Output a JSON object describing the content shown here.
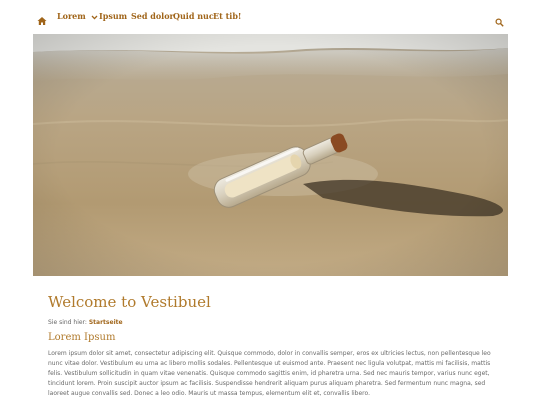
{
  "nav": {
    "home_icon": "home-icon",
    "items": [
      {
        "label": "Lorem",
        "has_dropdown": true
      },
      {
        "label": "Ipsum"
      },
      {
        "label": "Sed dolor"
      },
      {
        "label": "Quid nuc"
      },
      {
        "label": "Et tib!"
      }
    ],
    "search_icon": "search-icon",
    "accent_color": "#a0651a"
  },
  "hero": {
    "image": "message-in-a-bottle-on-beach"
  },
  "page": {
    "title": "Welcome to Vestibuel",
    "breadcrumb_prefix": "Sie sind hier:",
    "breadcrumb_link": "Startseite",
    "section_title": "Lorem Ipsum",
    "body": "Lorem ipsum dolor sit amet, consectetur adipiscing elit. Quisque commodo, dolor in convallis semper, eros ex ultricies lectus, non pellentesque leo nunc vitae dolor. Vestibulum eu urna ac libero mollis sodales. Pellentesque ut euismod ante. Praesent nec ligula volutpat, mattis mi facilisis, mattis felis. Vestibulum sollicitudin in quam vitae venenatis. Quisque commodo sagittis enim, id pharetra urna. Sed nec mauris tempor, varius nunc eget, tincidunt lorem. Proin suscipit auctor ipsum ac facilisis. Suspendisse hendrerit aliquam purus aliquam pharetra. Sed fermentum nunc magna, sed laoreet augue convallis sed. Donec a leo odio. Mauris ut massa tempus, elementum elit et, convallis libero."
  }
}
